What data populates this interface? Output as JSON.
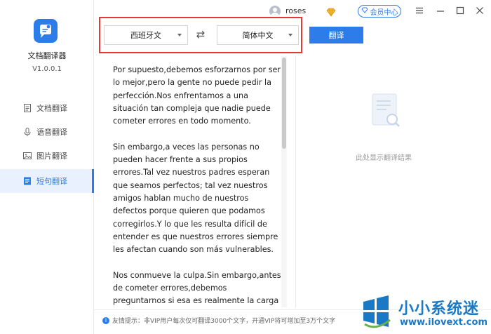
{
  "app": {
    "name": "文档翻译器",
    "version": "V1.0.0.1"
  },
  "sidebar": {
    "items": [
      {
        "label": "文档翻译",
        "icon": "document-icon",
        "active": false
      },
      {
        "label": "语音翻译",
        "icon": "microphone-icon",
        "active": false
      },
      {
        "label": "图片翻译",
        "icon": "image-icon",
        "active": false
      },
      {
        "label": "短句翻译",
        "icon": "text-icon",
        "active": true
      }
    ]
  },
  "titlebar": {
    "username": "roses",
    "vip_label": "会员中心"
  },
  "translate_bar": {
    "source_lang": "西班牙文",
    "target_lang": "简体中文",
    "translate_label": "翻译"
  },
  "source": {
    "paragraphs": [
      "Por supuesto,debemos esforzarnos por ser lo mejor,pero la gente no puede pedir la perfección.Nos enfrentamos a una situación tan compleja que nadie puede cometer errores en todo momento.",
      "Sin embargo,a veces las personas no pueden hacer frente a sus propios errores.Tal vez nuestros padres esperan que seamos perfectos; tal vez nuestros amigos hablan mucho de nuestros defectos porque quieren que podamos corregirlos.Y lo que les resulta difícil de entender es que nuestros errores siempre les afectan cuando son más vulnerables.",
      "Nos conmueve la culpa.Sin embargo,antes de cometer errores,debemos preguntarnos si esa es realmente la carga que debemos asumir."
    ]
  },
  "result": {
    "placeholder": "此处显示翻译结果"
  },
  "footer": {
    "tip": "友情提示：非VIP用户每次仅可翻译3000个文字，开通VIP将可增加至3万个文字"
  },
  "watermark": {
    "title": "小小系统迷",
    "url": "www.ilovext.com"
  },
  "colors": {
    "accent": "#2c7de9",
    "highlight_box": "#e53935",
    "active_nav_bg": "#e8f1fd"
  }
}
